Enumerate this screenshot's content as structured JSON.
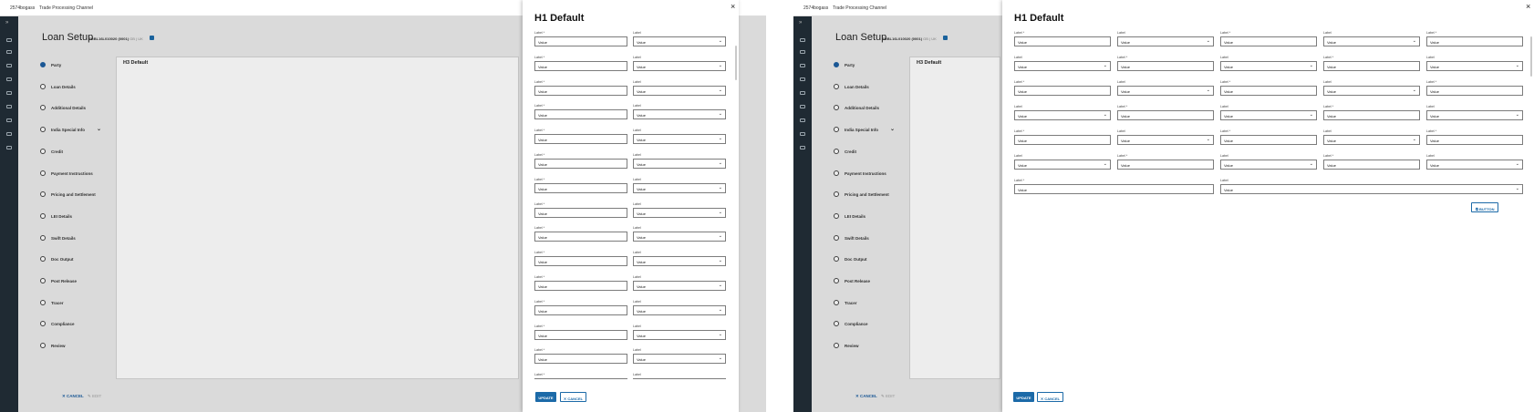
{
  "topbar": {
    "user": "2574bogass",
    "channel": "Trade Processing Channel"
  },
  "page": {
    "title": "Loan Setup",
    "ref_id": "EGBL16L010020 (0001)",
    "ref_meta": "GB | UK"
  },
  "steps": [
    {
      "label": "Party"
    },
    {
      "label": "Loan Details"
    },
    {
      "label": "Additional Details"
    },
    {
      "label": "India Special Info"
    },
    {
      "label": "Credit"
    },
    {
      "label": "Payment Instructions"
    },
    {
      "label": "Pricing and Settlement"
    },
    {
      "label": "LEI Details"
    },
    {
      "label": "Swift Details"
    },
    {
      "label": "Doc Output"
    },
    {
      "label": "Post Release"
    },
    {
      "label": "Tracer"
    },
    {
      "label": "Compliance"
    },
    {
      "label": "Review"
    }
  ],
  "card": {
    "title": "H3 Default"
  },
  "footer": {
    "cancel": "CANCEL",
    "edit": "EDIT"
  },
  "panel": {
    "title": "H1 Default",
    "close": "×",
    "update": "UPDATE",
    "cancel": "CANCEL",
    "side_button": "BUTTON"
  },
  "form": {
    "label_required": "Label *",
    "label": "Label",
    "value": "Value"
  },
  "icons": {
    "close": "close-icon",
    "chevron": "chevron-down-icon",
    "rail_expand": "double-chevron-right-icon",
    "side_button": "edit-icon"
  },
  "colors": {
    "primary": "#1c6aa8",
    "active_step": "#1c5ea0",
    "rail": "#1f2a33"
  }
}
